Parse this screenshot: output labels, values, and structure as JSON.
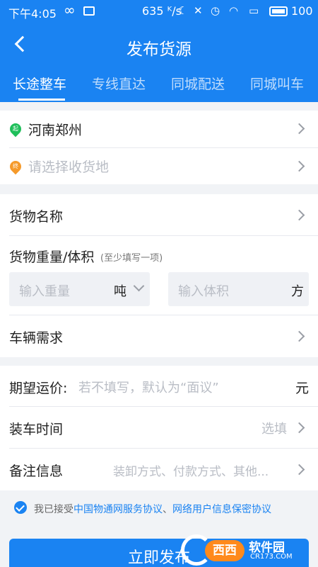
{
  "status_bar": {
    "time": "下午4:05",
    "speed": "635 ᴷ/s",
    "battery": "100"
  },
  "header": {
    "title": "发布货源",
    "tabs": [
      {
        "label": "长途整车",
        "active": true
      },
      {
        "label": "专线直达",
        "active": false
      },
      {
        "label": "同城配送",
        "active": false
      },
      {
        "label": "同城叫车",
        "active": false
      }
    ]
  },
  "route": {
    "origin_badge": "起",
    "origin": "河南郑州",
    "dest_badge": "终",
    "dest_placeholder": "请选择收货地"
  },
  "cargo": {
    "name_label": "货物名称",
    "weight_volume_label": "货物重量/体积",
    "weight_volume_hint": "(至少填写一项)",
    "weight_placeholder": "输入重量",
    "weight_unit": "吨",
    "volume_placeholder": "输入体积",
    "volume_unit": "方",
    "vehicle_label": "车辆需求"
  },
  "details": {
    "price_label": "期望运价:",
    "price_placeholder": "若不填写，默认为“面议”",
    "price_unit": "元",
    "loading_label": "装车时间",
    "loading_placeholder": "选填",
    "notes_label": "备注信息",
    "notes_placeholder": "装卸方式、付款方式、其他..."
  },
  "agreement": {
    "prefix": "我已接受",
    "link1": "中国物通网服务协议",
    "sep": "、",
    "link2": "网络用户信息保密协议",
    "checked": true
  },
  "submit_label": "立即发布",
  "watermark": {
    "badge": "西西",
    "text": "软件园",
    "sub": "CR173.COM"
  },
  "colors": {
    "primary": "#1a83f2",
    "origin_pin": "#1fbf5a",
    "dest_pin": "#f59a2b"
  }
}
